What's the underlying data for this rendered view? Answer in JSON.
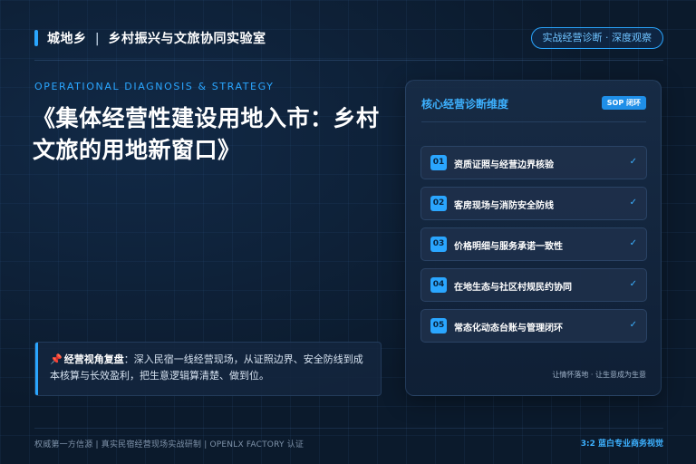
{
  "header": {
    "brand": "城地乡",
    "separator": "|",
    "title": "乡村振兴与文旅协同实验室",
    "badge": "实战经营诊断 · 深度观察"
  },
  "hero": {
    "subtitle_en": "OPERATIONAL DIAGNOSIS & STRATEGY",
    "title": "《集体经营性建设用地入市：乡村文旅的用地新窗口》"
  },
  "insight": {
    "pin_icon": "pushpin-icon",
    "label": "经营视角复盘",
    "text": "：深入民宿一线经营现场，从证照边界、安全防线到成本核算与长效盈利，把生意逻辑算清楚、做到位。"
  },
  "card": {
    "title": "核心经营诊断维度",
    "badge": "SOP 闭环",
    "items": [
      {
        "num": "01",
        "label": "资质证照与经营边界核验",
        "check": "✓"
      },
      {
        "num": "02",
        "label": "客房现场与消防安全防线",
        "check": "✓"
      },
      {
        "num": "03",
        "label": "价格明细与服务承诺一致性",
        "check": "✓"
      },
      {
        "num": "04",
        "label": "在地生态与社区村规民约协同",
        "check": "✓"
      },
      {
        "num": "05",
        "label": "常态化动态台账与管理闭环",
        "check": "✓"
      }
    ],
    "footer": "让情怀落地 · 让生意成为生意"
  },
  "footer": {
    "left": "权威第一方信源 | 真实民宿经营现场实战研制 | OPENLX FACTORY 认证",
    "right": "3:2 蓝白专业商务视觉"
  },
  "colors": {
    "accent": "#2aa6ff",
    "background": "#0b1a2c"
  }
}
